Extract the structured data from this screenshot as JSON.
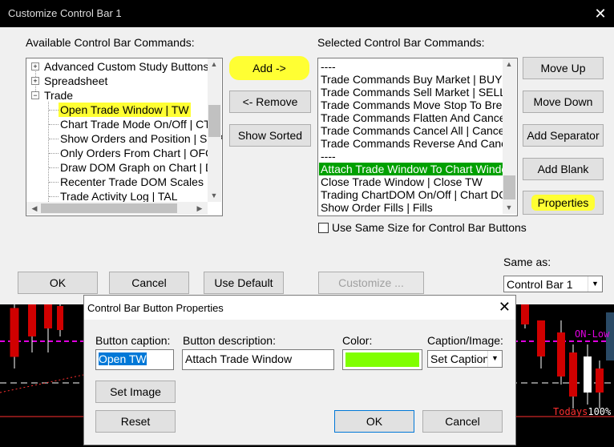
{
  "main_dialog": {
    "title": "Customize Control Bar 1",
    "available_label": "Available Control Bar Commands:",
    "selected_label": "Selected Control Bar Commands:",
    "tree": [
      {
        "label": "Advanced Custom Study Buttons",
        "kind": "folder",
        "expand": "+"
      },
      {
        "label": "Spreadsheet",
        "kind": "folder",
        "expand": "+"
      },
      {
        "label": "Trade",
        "kind": "folder",
        "expand": "−"
      },
      {
        "label": "Open Trade Window | TW",
        "kind": "item",
        "selected": true
      },
      {
        "label": "Chart Trade Mode On/Off | CTM",
        "kind": "item"
      },
      {
        "label": "Show Orders and Position | SOP",
        "kind": "item"
      },
      {
        "label": "Only Orders From Chart | OFC",
        "kind": "item"
      },
      {
        "label": "Draw DOM Graph on Chart | DDG",
        "kind": "item"
      },
      {
        "label": "Recenter Trade DOM Scales | R",
        "kind": "item"
      },
      {
        "label": "Trade Activity Log | TAL",
        "kind": "item"
      }
    ],
    "selected_list": [
      "----",
      "Trade Commands Buy Market | BUY",
      "Trade Commands Sell Market | SELL",
      "Trade Commands Move Stop To Breakeven",
      "Trade Commands Flatten And Cancel",
      "Trade Commands Cancel All | Cancel",
      "Trade Commands Reverse And Cancel",
      "----",
      "Attach Trade Window To Chart Window",
      "Close Trade Window | Close TW",
      "Trading ChartDOM On/Off | Chart DOM",
      "Show Order Fills | Fills"
    ],
    "selected_index": 8,
    "buttons": {
      "add": "Add ->",
      "remove": "<- Remove",
      "show_sorted": "Show Sorted",
      "move_up": "Move Up",
      "move_down": "Move Down",
      "add_separator": "Add Separator",
      "add_blank": "Add Blank",
      "properties": "Properties",
      "ok": "OK",
      "cancel": "Cancel",
      "use_default": "Use Default",
      "customize": "Customize ..."
    },
    "same_size_label": "Use Same Size for Control Bar Buttons",
    "same_size_checked": false,
    "same_as_label": "Same as:",
    "same_as_value": "Control Bar 1"
  },
  "props_dialog": {
    "title": "Control Bar Button Properties",
    "caption_label": "Button caption:",
    "caption_value": "Open TW",
    "description_label": "Button description:",
    "description_value": "Attach Trade Window",
    "color_label": "Color:",
    "color_value": "#80ff00",
    "caption_image_label": "Caption/Image:",
    "caption_image_value": "Set Caption",
    "set_image": "Set Image",
    "reset": "Reset",
    "ok": "OK",
    "cancel": "Cancel"
  },
  "chart": {
    "on_low_label": "ON-Low",
    "todays_label": "Todays",
    "todays_pct": "100%"
  },
  "colors": {
    "highlight_yellow": "#ffff33",
    "selected_green": "#00a000",
    "magenta_line": "#e000e0"
  }
}
